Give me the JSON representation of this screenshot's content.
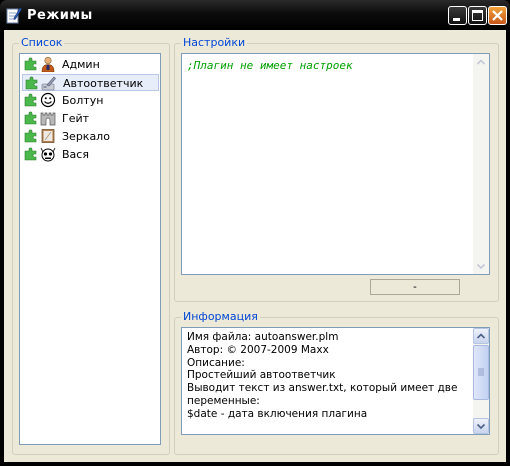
{
  "window": {
    "title": "Режимы"
  },
  "list_group": {
    "title": "Список",
    "items": [
      {
        "label": "Админ",
        "icon": "admin-person-icon",
        "selected": false
      },
      {
        "label": "Автоответчик",
        "icon": "answering-machine-icon",
        "selected": true
      },
      {
        "label": "Болтун",
        "icon": "smiley-icon",
        "selected": false
      },
      {
        "label": "Гейт",
        "icon": "castle-gate-icon",
        "selected": false
      },
      {
        "label": "Зеркало",
        "icon": "mirror-icon",
        "selected": false
      },
      {
        "label": "Вася",
        "icon": "robot-face-icon",
        "selected": false
      }
    ]
  },
  "settings_group": {
    "title": "Настройки",
    "editor_text": ";Плагин не имеет настроек",
    "status": "-"
  },
  "info_group": {
    "title": "Информация",
    "lines": [
      "Имя файла: autoanswer.plm",
      "Автор: © 2007-2009 Maxx",
      "Описание:",
      "Простейший автоответчик",
      "Выводит текст из answer.txt, который имеет две",
      "переменные:",
      "$date - дата включения плагина"
    ]
  },
  "colors": {
    "group_title": "#0046d5",
    "editor_text": "#00a000",
    "window_bg": "#ece9d8"
  }
}
